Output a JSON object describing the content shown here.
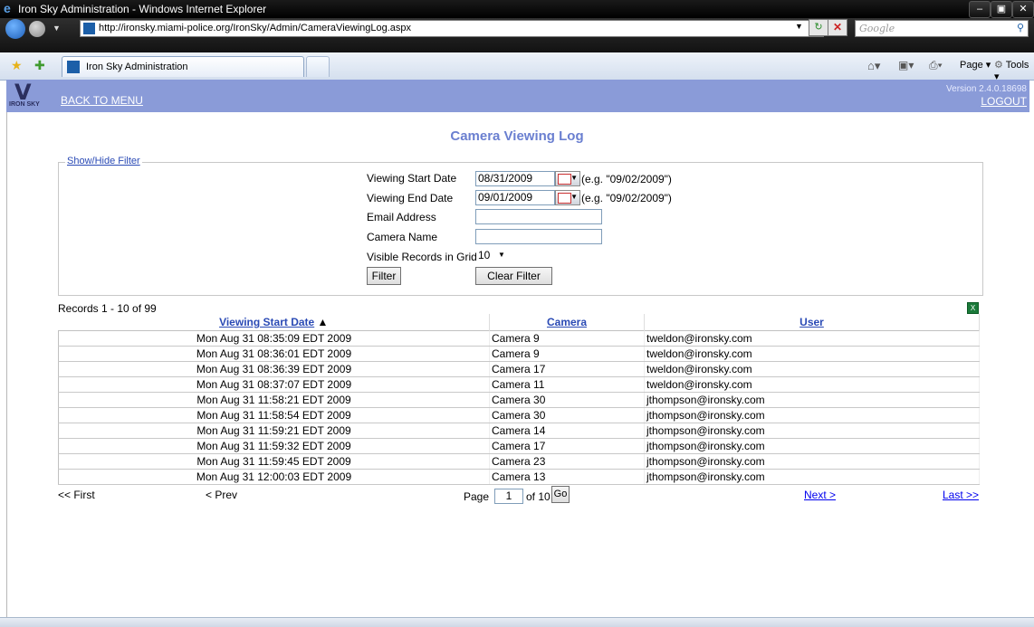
{
  "window": {
    "title": "Iron Sky Administration - Windows Internet Explorer"
  },
  "browser": {
    "url": "http://ironsky.miami-police.org/IronSky/Admin/CameraViewingLog.aspx",
    "search_placeholder": "Google",
    "tab_label": "Iron Sky Administration",
    "commands": [
      "Page",
      "Tools"
    ]
  },
  "header": {
    "logo_text": "IRON SKY",
    "back_link": "BACK TO MENU",
    "version": "Version 2.4.0.18698",
    "logout": "LOGOUT"
  },
  "page": {
    "title": "Camera Viewing Log"
  },
  "filter": {
    "toggle": "Show/Hide Filter",
    "start_label": "Viewing Start Date",
    "start_value": "08/31/2009",
    "start_hint": "(e.g. \"09/02/2009\")",
    "end_label": "Viewing End Date",
    "end_value": "09/01/2009",
    "end_hint": "(e.g. \"09/02/2009\")",
    "email_label": "Email Address",
    "email_value": "",
    "camera_label": "Camera Name",
    "camera_value": "",
    "visible_label": "Visible Records in Grid",
    "visible_value": "10",
    "filter_btn": "Filter",
    "clear_btn": "Clear Filter"
  },
  "grid": {
    "records": "Records 1 - 10 of 99",
    "columns": [
      "Viewing Start Date",
      "Camera",
      "User"
    ],
    "sort_indicator": "▲",
    "rows": [
      [
        "Mon Aug 31 08:35:09 EDT 2009",
        "Camera 9",
        "tweldon@ironsky.com"
      ],
      [
        "Mon Aug 31 08:36:01 EDT 2009",
        "Camera 9",
        "tweldon@ironsky.com"
      ],
      [
        "Mon Aug 31 08:36:39 EDT 2009",
        "Camera 17",
        "tweldon@ironsky.com"
      ],
      [
        "Mon Aug 31 08:37:07 EDT 2009",
        "Camera 11",
        "tweldon@ironsky.com"
      ],
      [
        "Mon Aug 31 11:58:21 EDT 2009",
        "Camera 30",
        "jthompson@ironsky.com"
      ],
      [
        "Mon Aug 31 11:58:54 EDT 2009",
        "Camera 30",
        "jthompson@ironsky.com"
      ],
      [
        "Mon Aug 31 11:59:21 EDT 2009",
        "Camera 14",
        "jthompson@ironsky.com"
      ],
      [
        "Mon Aug 31 11:59:32 EDT 2009",
        "Camera 17",
        "jthompson@ironsky.com"
      ],
      [
        "Mon Aug 31 11:59:45 EDT 2009",
        "Camera 23",
        "jthompson@ironsky.com"
      ],
      [
        "Mon Aug 31 12:00:03 EDT 2009",
        "Camera 13",
        "jthompson@ironsky.com"
      ]
    ]
  },
  "pager": {
    "first": "<< First",
    "prev": "< Prev",
    "page_label": "Page",
    "page_value": "1",
    "of_label": "of 10",
    "go": "Go",
    "next": "Next >",
    "last": "Last >>"
  }
}
